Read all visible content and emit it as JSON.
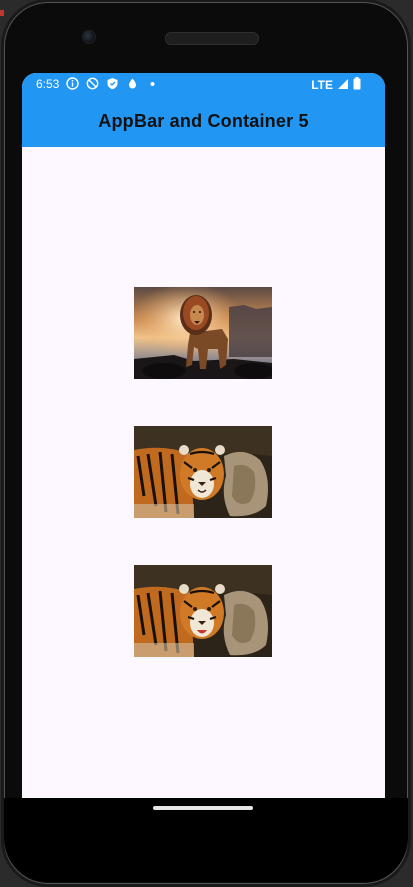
{
  "status_bar": {
    "time": "6:53",
    "network": "LTE"
  },
  "app_bar": {
    "title": "AppBar and Container 5"
  },
  "images": [
    {
      "name": "lion-image",
      "description_icon": "lion"
    },
    {
      "name": "tiger-image-1",
      "description_icon": "tiger"
    },
    {
      "name": "tiger-image-2",
      "description_icon": "tiger"
    }
  ],
  "colors": {
    "app_bar": "#2196f3",
    "body_background": "#fdf7ff",
    "title_text": "#111111"
  }
}
